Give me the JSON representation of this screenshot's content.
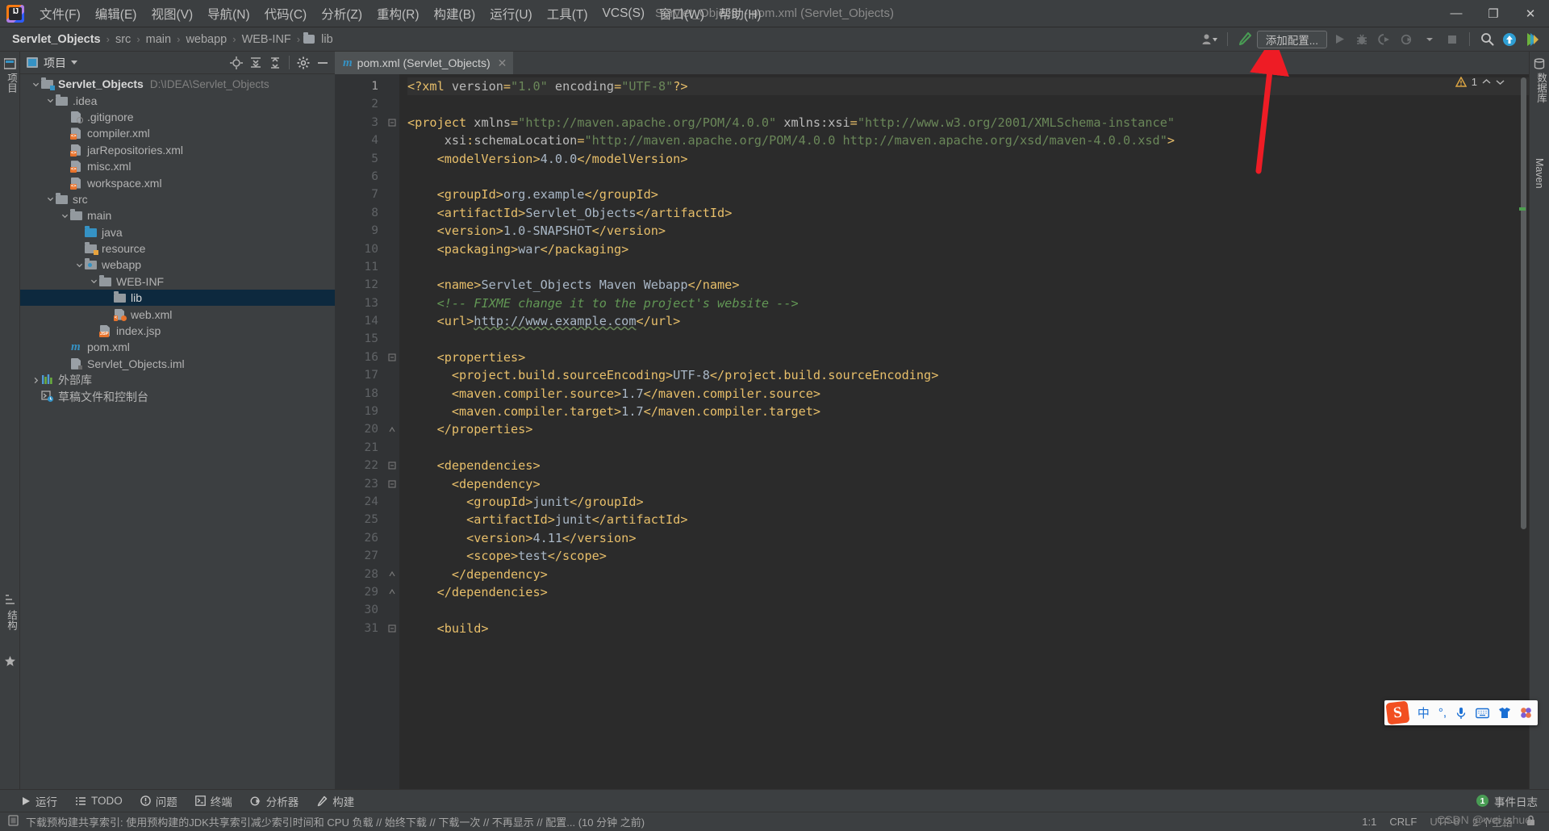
{
  "window": {
    "title": "Servlet_Objects - pom.xml (Servlet_Objects)",
    "minimize": "—",
    "maximize": "❐",
    "close": "✕"
  },
  "menubar": {
    "items": [
      {
        "label": "文件(F)"
      },
      {
        "label": "编辑(E)"
      },
      {
        "label": "视图(V)"
      },
      {
        "label": "导航(N)"
      },
      {
        "label": "代码(C)"
      },
      {
        "label": "分析(Z)"
      },
      {
        "label": "重构(R)"
      },
      {
        "label": "构建(B)"
      },
      {
        "label": "运行(U)"
      },
      {
        "label": "工具(T)"
      },
      {
        "label": "VCS(S)"
      },
      {
        "label": "窗口(W)"
      },
      {
        "label": "帮助(H)"
      }
    ]
  },
  "breadcrumb": {
    "items": [
      "Servlet_Objects",
      "src",
      "main",
      "webapp",
      "WEB-INF",
      "lib"
    ],
    "separator": "›"
  },
  "toolbar": {
    "add_configuration": "添加配置...",
    "icons": [
      "user-accounts-icon",
      "build-hammer-icon",
      "run-icon",
      "debug-icon",
      "run-with-coverage-icon",
      "profile-icon",
      "stop-icon",
      "search-everywhere-icon",
      "update-project-icon",
      "idea-feature-icon"
    ]
  },
  "project_panel": {
    "title": "项目",
    "actions": [
      "locate-icon",
      "expand-all-icon",
      "collapse-all-icon",
      "settings-gear-icon",
      "hide-icon"
    ],
    "tree": [
      {
        "label": "Servlet_Objects",
        "path": "D:\\IDEA\\Servlet_Objects",
        "depth": 0,
        "icon": "module-folder",
        "arrow": "down",
        "bold": true
      },
      {
        "label": ".idea",
        "depth": 1,
        "icon": "folder",
        "arrow": "down"
      },
      {
        "label": ".gitignore",
        "depth": 2,
        "icon": "gitignore-file"
      },
      {
        "label": "compiler.xml",
        "depth": 2,
        "icon": "xml-file"
      },
      {
        "label": "jarRepositories.xml",
        "depth": 2,
        "icon": "xml-file"
      },
      {
        "label": "misc.xml",
        "depth": 2,
        "icon": "xml-file"
      },
      {
        "label": "workspace.xml",
        "depth": 2,
        "icon": "xml-file"
      },
      {
        "label": "src",
        "depth": 1,
        "icon": "folder",
        "arrow": "down"
      },
      {
        "label": "main",
        "depth": 2,
        "icon": "folder",
        "arrow": "down"
      },
      {
        "label": "java",
        "depth": 3,
        "icon": "source-folder"
      },
      {
        "label": "resource",
        "depth": 3,
        "icon": "resource-folder"
      },
      {
        "label": "webapp",
        "depth": 3,
        "icon": "web-folder",
        "arrow": "down"
      },
      {
        "label": "WEB-INF",
        "depth": 4,
        "icon": "folder",
        "arrow": "down"
      },
      {
        "label": "lib",
        "depth": 5,
        "icon": "folder",
        "selected": true
      },
      {
        "label": "web.xml",
        "depth": 5,
        "icon": "web-xml-file"
      },
      {
        "label": "index.jsp",
        "depth": 4,
        "icon": "jsp-file"
      },
      {
        "label": "pom.xml",
        "depth": 2,
        "icon": "maven-file"
      },
      {
        "label": "Servlet_Objects.iml",
        "depth": 2,
        "icon": "iml-file"
      },
      {
        "label": "外部库",
        "depth": 0,
        "icon": "library-icon",
        "arrow": "right"
      },
      {
        "label": "草稿文件和控制台",
        "depth": 0,
        "icon": "scratches-icon"
      }
    ]
  },
  "editor": {
    "tab": {
      "label": "pom.xml (Servlet_Objects)",
      "icon": "maven-m-icon",
      "close": "✕"
    },
    "inspection": {
      "warning_count": "1",
      "warning_icon": "warning-triangle-icon"
    },
    "lines": [
      {
        "n": 1,
        "fold": "",
        "cur": true,
        "tokens": [
          {
            "t": "<?xml ",
            "c": "tg"
          },
          {
            "t": "version",
            "c": "at"
          },
          {
            "t": "=",
            "c": "tg"
          },
          {
            "t": "\"1.0\"",
            "c": "st"
          },
          {
            "t": " ",
            "c": "txt"
          },
          {
            "t": "encoding",
            "c": "at"
          },
          {
            "t": "=",
            "c": "tg"
          },
          {
            "t": "\"UTF-8\"",
            "c": "st"
          },
          {
            "t": "?>",
            "c": "tg"
          }
        ]
      },
      {
        "n": 2,
        "fold": "",
        "tokens": []
      },
      {
        "n": 3,
        "fold": "open",
        "tokens": [
          {
            "t": "<project ",
            "c": "tg"
          },
          {
            "t": "xmlns",
            "c": "at"
          },
          {
            "t": "=",
            "c": "tg"
          },
          {
            "t": "\"http://maven.apache.org/POM/4.0.0\"",
            "c": "st"
          },
          {
            "t": " ",
            "c": "txt"
          },
          {
            "t": "xmlns:xsi",
            "c": "at"
          },
          {
            "t": "=",
            "c": "tg"
          },
          {
            "t": "\"http://www.w3.org/2001/XMLSchema-instance\"",
            "c": "st"
          }
        ]
      },
      {
        "n": 4,
        "fold": "",
        "tokens": [
          {
            "t": "     ",
            "c": "txt"
          },
          {
            "t": "xsi",
            "c": "at"
          },
          {
            "t": ":",
            "c": "tg"
          },
          {
            "t": "schemaLocation",
            "c": "at"
          },
          {
            "t": "=",
            "c": "tg"
          },
          {
            "t": "\"http://maven.apache.org/POM/4.0.0 http://maven.apache.org/xsd/maven-4.0.0.xsd\"",
            "c": "st"
          },
          {
            "t": ">",
            "c": "tg"
          }
        ]
      },
      {
        "n": 5,
        "fold": "",
        "tokens": [
          {
            "t": "    <modelVersion>",
            "c": "tg"
          },
          {
            "t": "4.0.0",
            "c": "txt"
          },
          {
            "t": "</modelVersion>",
            "c": "tg"
          }
        ]
      },
      {
        "n": 6,
        "fold": "",
        "tokens": []
      },
      {
        "n": 7,
        "fold": "",
        "tokens": [
          {
            "t": "    <groupId>",
            "c": "tg"
          },
          {
            "t": "org.example",
            "c": "txt"
          },
          {
            "t": "</groupId>",
            "c": "tg"
          }
        ]
      },
      {
        "n": 8,
        "fold": "",
        "tokens": [
          {
            "t": "    <artifactId>",
            "c": "tg"
          },
          {
            "t": "Servlet_Objects",
            "c": "txt"
          },
          {
            "t": "</artifactId>",
            "c": "tg"
          }
        ]
      },
      {
        "n": 9,
        "fold": "",
        "tokens": [
          {
            "t": "    <version>",
            "c": "tg"
          },
          {
            "t": "1.0-SNAPSHOT",
            "c": "txt"
          },
          {
            "t": "</version>",
            "c": "tg"
          }
        ]
      },
      {
        "n": 10,
        "fold": "",
        "tokens": [
          {
            "t": "    <packaging>",
            "c": "tg"
          },
          {
            "t": "war",
            "c": "txt"
          },
          {
            "t": "</packaging>",
            "c": "tg"
          }
        ]
      },
      {
        "n": 11,
        "fold": "",
        "tokens": []
      },
      {
        "n": 12,
        "fold": "",
        "tokens": [
          {
            "t": "    <name>",
            "c": "tg"
          },
          {
            "t": "Servlet_Objects Maven Webapp",
            "c": "txt"
          },
          {
            "t": "</name>",
            "c": "tg"
          }
        ]
      },
      {
        "n": 13,
        "fold": "",
        "tokens": [
          {
            "t": "    ",
            "c": "txt"
          },
          {
            "t": "<!-- FIXME change it to the project's website -->",
            "c": "cm"
          }
        ]
      },
      {
        "n": 14,
        "fold": "",
        "tokens": [
          {
            "t": "    <url>",
            "c": "tg"
          },
          {
            "t": "http://www.example.com",
            "c": "wavy"
          },
          {
            "t": "</url>",
            "c": "tg"
          }
        ]
      },
      {
        "n": 15,
        "fold": "",
        "tokens": []
      },
      {
        "n": 16,
        "fold": "open",
        "tokens": [
          {
            "t": "    <properties>",
            "c": "tg"
          }
        ]
      },
      {
        "n": 17,
        "fold": "",
        "tokens": [
          {
            "t": "      <project.build.sourceEncoding>",
            "c": "tg"
          },
          {
            "t": "UTF-8",
            "c": "txt"
          },
          {
            "t": "</project.build.sourceEncoding>",
            "c": "tg"
          }
        ]
      },
      {
        "n": 18,
        "fold": "",
        "tokens": [
          {
            "t": "      <maven.compiler.source>",
            "c": "tg"
          },
          {
            "t": "1.7",
            "c": "txt"
          },
          {
            "t": "</maven.compiler.source>",
            "c": "tg"
          }
        ]
      },
      {
        "n": 19,
        "fold": "",
        "tokens": [
          {
            "t": "      <maven.compiler.target>",
            "c": "tg"
          },
          {
            "t": "1.7",
            "c": "txt"
          },
          {
            "t": "</maven.compiler.target>",
            "c": "tg"
          }
        ]
      },
      {
        "n": 20,
        "fold": "close",
        "tokens": [
          {
            "t": "    </properties>",
            "c": "tg"
          }
        ]
      },
      {
        "n": 21,
        "fold": "",
        "tokens": []
      },
      {
        "n": 22,
        "fold": "open",
        "tokens": [
          {
            "t": "    <dependencies>",
            "c": "tg"
          }
        ]
      },
      {
        "n": 23,
        "fold": "open",
        "tokens": [
          {
            "t": "      <dependency>",
            "c": "tg"
          }
        ]
      },
      {
        "n": 24,
        "fold": "",
        "tokens": [
          {
            "t": "        <groupId>",
            "c": "tg"
          },
          {
            "t": "junit",
            "c": "txt"
          },
          {
            "t": "</groupId>",
            "c": "tg"
          }
        ]
      },
      {
        "n": 25,
        "fold": "",
        "tokens": [
          {
            "t": "        <artifactId>",
            "c": "tg"
          },
          {
            "t": "junit",
            "c": "txt"
          },
          {
            "t": "</artifactId>",
            "c": "tg"
          }
        ]
      },
      {
        "n": 26,
        "fold": "",
        "tokens": [
          {
            "t": "        <version>",
            "c": "tg"
          },
          {
            "t": "4.11",
            "c": "txt"
          },
          {
            "t": "</version>",
            "c": "tg"
          }
        ]
      },
      {
        "n": 27,
        "fold": "",
        "tokens": [
          {
            "t": "        <scope>",
            "c": "tg"
          },
          {
            "t": "test",
            "c": "txt"
          },
          {
            "t": "</scope>",
            "c": "tg"
          }
        ]
      },
      {
        "n": 28,
        "fold": "close",
        "tokens": [
          {
            "t": "      </dependency>",
            "c": "tg"
          }
        ]
      },
      {
        "n": 29,
        "fold": "close",
        "tokens": [
          {
            "t": "    </dependencies>",
            "c": "tg"
          }
        ]
      },
      {
        "n": 30,
        "fold": "",
        "tokens": []
      },
      {
        "n": 31,
        "fold": "open",
        "tokens": [
          {
            "t": "    <build>",
            "c": "tg"
          }
        ]
      }
    ]
  },
  "left_strip": {
    "labels": [
      "项目",
      "结构",
      "收藏"
    ]
  },
  "right_strip": {
    "labels": [
      "数据库",
      "Maven"
    ]
  },
  "bottom_tools": {
    "items": [
      {
        "label": "运行",
        "icon": "run-icon"
      },
      {
        "label": "TODO",
        "icon": "todo-icon"
      },
      {
        "label": "问题",
        "icon": "problems-icon"
      },
      {
        "label": "终端",
        "icon": "terminal-icon"
      },
      {
        "label": "分析器",
        "icon": "profiler-icon"
      },
      {
        "label": "构建",
        "icon": "build-icon"
      }
    ],
    "event_log": {
      "label": "事件日志",
      "count": "1"
    }
  },
  "status_bar": {
    "message": "下载预构建共享索引: 使用预构建的JDK共享索引减少索引时间和 CPU 负载 // 始终下载 // 下载一次 // 不再显示 // 配置... (10 分钟 之前)",
    "caret": "1:1",
    "line_sep": "CRLF",
    "encoding": "UTF-8",
    "indent": "2 个空格",
    "lock_icon": "lock-icon"
  },
  "ime_bar": {
    "logo": "S",
    "items": [
      "中",
      "°,",
      "microphone-icon",
      "keyboard-icon",
      "skin-icon",
      "apps-icon"
    ]
  },
  "watermark": "CSDN @wei_shuo",
  "colors": {
    "accent_blue": "#3592c4",
    "selection": "#0d293e",
    "tag": "#e8bf6a",
    "string": "#6a8759",
    "comment": "#629755",
    "text": "#a9b7c6",
    "panel_bg": "#3c3f41",
    "editor_bg": "#2b2b2b",
    "annotation_arrow": "#ee1c25"
  }
}
